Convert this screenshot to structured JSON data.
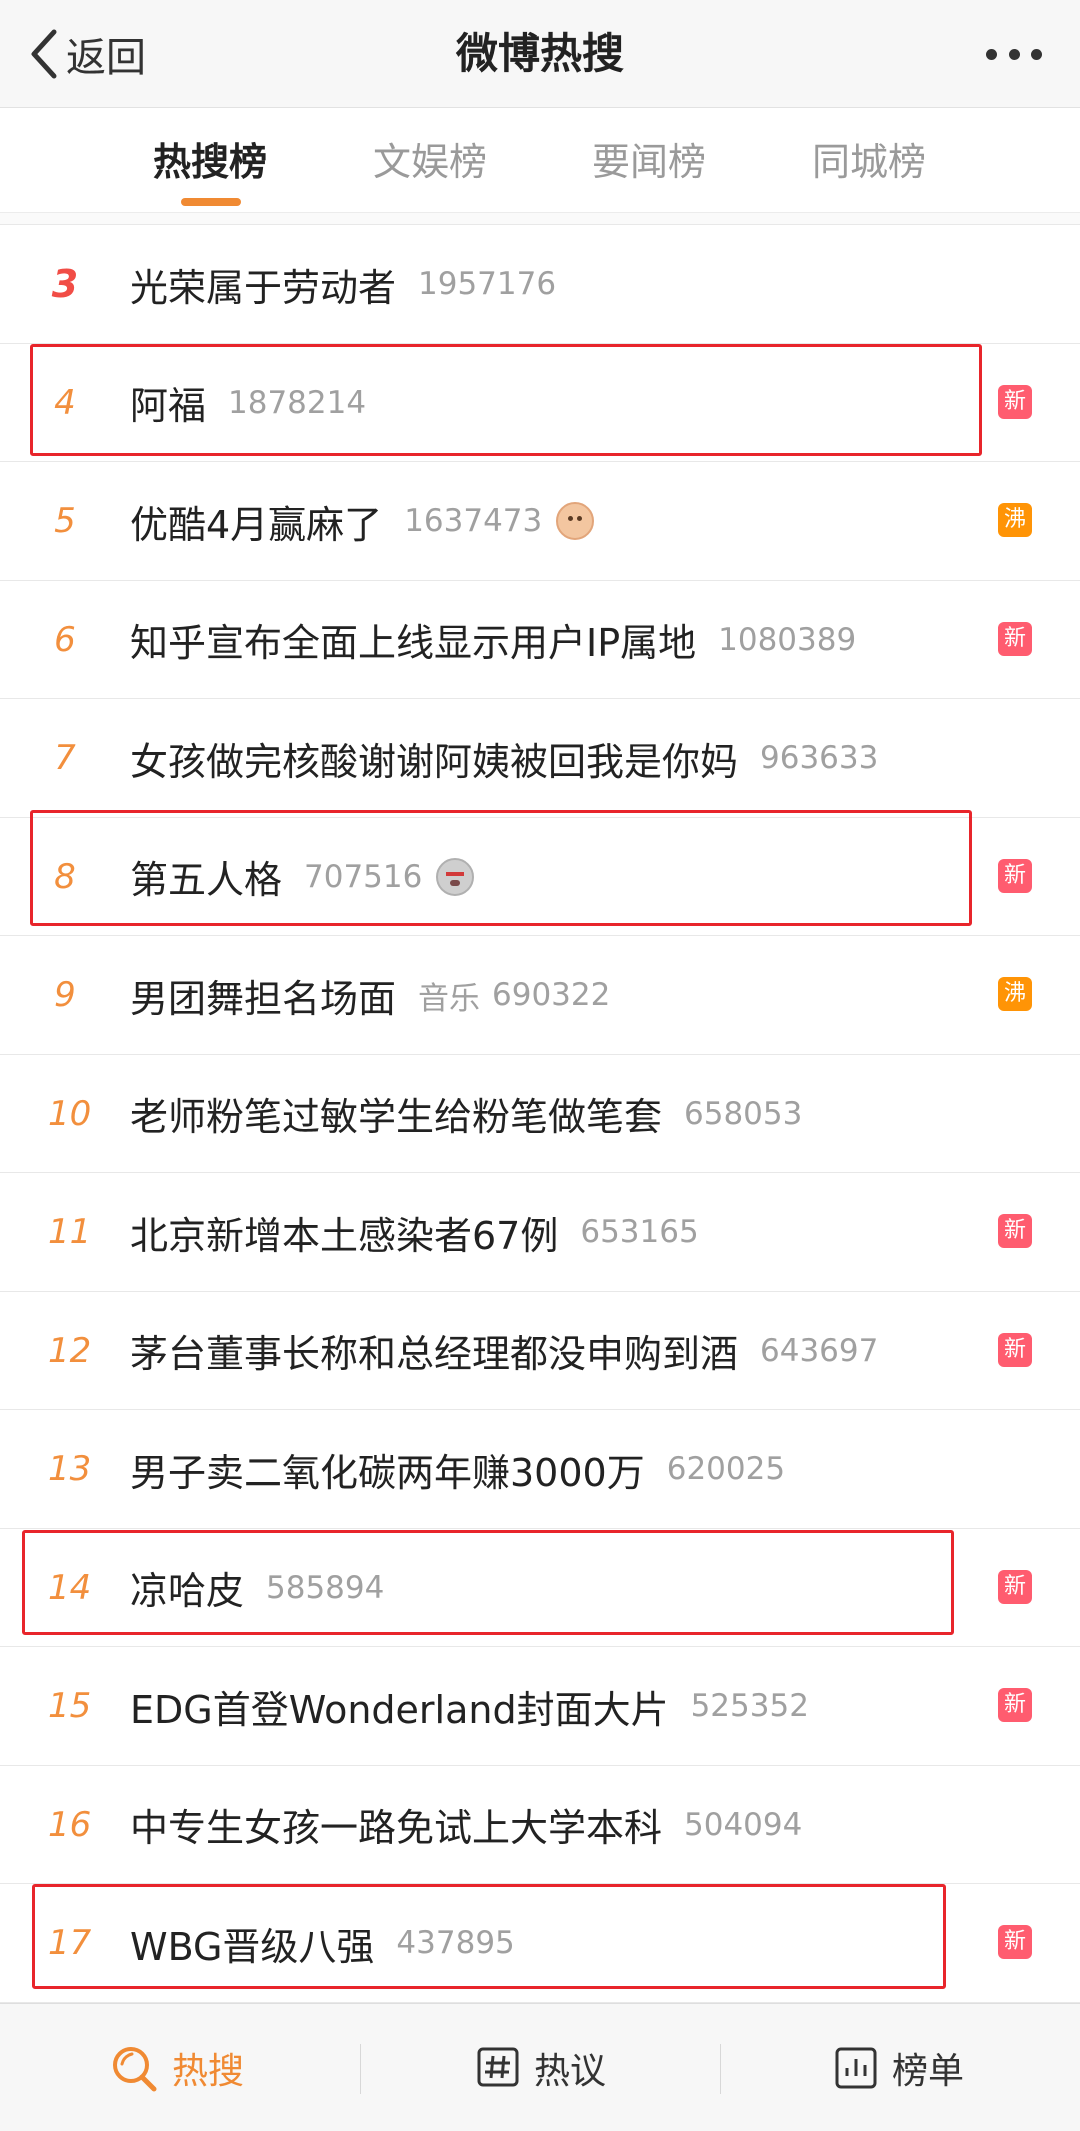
{
  "header": {
    "back_label": "返回",
    "title": "微博热搜"
  },
  "tabs": [
    {
      "label": "热搜榜",
      "active": true
    },
    {
      "label": "文娱榜",
      "active": false
    },
    {
      "label": "要闻榜",
      "active": false
    },
    {
      "label": "同城榜",
      "active": false
    }
  ],
  "rows": [
    {
      "rank": "3",
      "topic": "光荣属于劳动者",
      "count": "1957176"
    },
    {
      "rank": "4",
      "topic": "阿福",
      "count": "1878214",
      "badge": "新",
      "highlighted": true
    },
    {
      "rank": "5",
      "topic": "优酷4月赢麻了",
      "count": "1637473",
      "emoji": "dog-face-icon",
      "badge": "沸"
    },
    {
      "rank": "6",
      "topic": "知乎宣布全面上线显示用户IP属地",
      "count": "1080389",
      "badge": "新"
    },
    {
      "rank": "7",
      "topic": "女孩做完核酸谢谢阿姨被回我是你妈",
      "count": "963633"
    },
    {
      "rank": "8",
      "topic": "第五人格",
      "count": "707516",
      "emoji": "angry-face-icon",
      "badge": "新",
      "highlighted": true
    },
    {
      "rank": "9",
      "topic": "男团舞担名场面",
      "meta": "音乐",
      "count": "690322",
      "badge": "沸"
    },
    {
      "rank": "10",
      "topic": "老师粉笔过敏学生给粉笔做笔套",
      "count": "658053"
    },
    {
      "rank": "11",
      "topic": "北京新增本土感染者67例",
      "count": "653165",
      "badge": "新"
    },
    {
      "rank": "12",
      "topic": "茅台董事长称和总经理都没申购到酒",
      "count": "643697",
      "badge": "新"
    },
    {
      "rank": "13",
      "topic": "男子卖二氧化碳两年赚3000万",
      "count": "620025"
    },
    {
      "rank": "14",
      "topic": "凉哈皮",
      "count": "585894",
      "badge": "新",
      "highlighted": true
    },
    {
      "rank": "15",
      "topic": "EDG首登Wonderland封面大片",
      "count": "525352",
      "badge": "新"
    },
    {
      "rank": "16",
      "topic": "中专生女孩一路免试上大学本科",
      "count": "504094"
    },
    {
      "rank": "17",
      "topic": "WBG晋级八强",
      "count": "437895",
      "badge": "新",
      "highlighted": true
    }
  ],
  "bottom_nav": [
    {
      "label": "热搜",
      "icon": "hot-search-icon",
      "active": true
    },
    {
      "label": "热议",
      "icon": "hashtag-icon",
      "active": false
    },
    {
      "label": "榜单",
      "icon": "chart-icon",
      "active": false
    }
  ],
  "colors": {
    "accent": "#f08a33",
    "rank_top": "#f14d46",
    "badge_new": "#ff5c6f",
    "badge_hot": "#ff9406",
    "highlight_box": "#e8252b"
  }
}
